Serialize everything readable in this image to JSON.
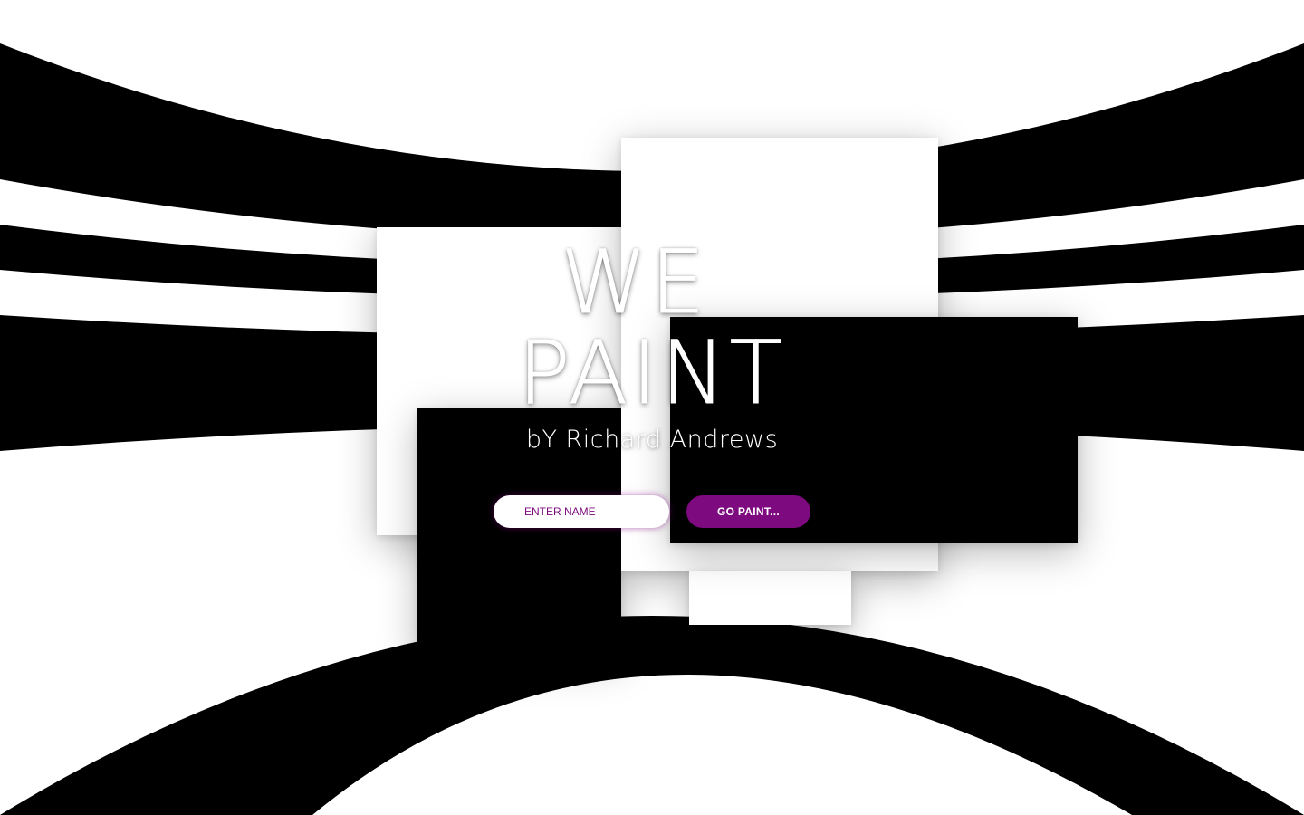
{
  "hero": {
    "title_line_1": "WE",
    "title_line_2": "PAINT",
    "byline": "bY Richard Andrews"
  },
  "form": {
    "name_placeholder": "ENTER NAME",
    "name_value": "",
    "submit_label": "GO PAINT..."
  },
  "colors": {
    "accent": "#7d0a7f",
    "background": "#ffffff",
    "stripes": "#000000"
  }
}
